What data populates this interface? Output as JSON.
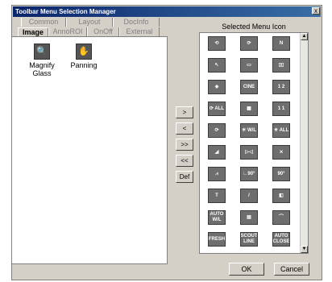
{
  "window": {
    "title": "Toolbar Menu Selection Manager",
    "close_label": "x"
  },
  "tabs": {
    "row1": [
      "Common",
      "Layout",
      "DocInfo"
    ],
    "row2": [
      "Image",
      "AnnoROI",
      "OnOff",
      "External"
    ],
    "active": "Image"
  },
  "available": [
    {
      "label": "Magnify Glass",
      "icon": "magnify-glass-icon",
      "glyph": "🔍"
    },
    {
      "label": "Panning",
      "icon": "hand-icon",
      "glyph": "✋"
    }
  ],
  "transfer_buttons": [
    ">",
    "<",
    ">>",
    "<<",
    "Def"
  ],
  "selected": {
    "header": "Selected Menu Icon",
    "icons": [
      {
        "name": "rotate-left-icon",
        "glyph": "⟲"
      },
      {
        "name": "rotate-right-icon",
        "glyph": "⟳"
      },
      {
        "name": "flip-icon",
        "glyph": "N"
      },
      {
        "name": "pointer-icon",
        "glyph": "↖"
      },
      {
        "name": "single-frame-icon",
        "glyph": "▭"
      },
      {
        "name": "dual-frame-icon",
        "glyph": "▯▯"
      },
      {
        "name": "stack-icon",
        "glyph": "◈"
      },
      {
        "name": "cine-icon",
        "glyph": "CINE"
      },
      {
        "name": "layout-1-2-icon",
        "glyph": "1 2"
      },
      {
        "name": "rotate-all-icon",
        "glyph": "⟳ ALL"
      },
      {
        "name": "grid-layout-icon",
        "glyph": "▦"
      },
      {
        "name": "layout-1-1-icon",
        "glyph": "1 1"
      },
      {
        "name": "rotate-icon",
        "glyph": "⟳"
      },
      {
        "name": "window-level-icon",
        "glyph": "☀ W/L"
      },
      {
        "name": "window-level-all-icon",
        "glyph": "☀ ALL"
      },
      {
        "name": "zoom-icon",
        "glyph": "◢"
      },
      {
        "name": "mirror-icon",
        "glyph": "▷◁"
      },
      {
        "name": "invert-icon",
        "glyph": "⨯"
      },
      {
        "name": "compass-icon",
        "glyph": "⩘"
      },
      {
        "name": "angle-90-icon",
        "glyph": "∟90°"
      },
      {
        "name": "angle-90-alt-icon",
        "glyph": "90°"
      },
      {
        "name": "text-icon",
        "glyph": "T"
      },
      {
        "name": "line-icon",
        "glyph": "/"
      },
      {
        "name": "contrast-icon",
        "glyph": "◧"
      },
      {
        "name": "auto-wl-icon",
        "glyph": "AUTO W/L"
      },
      {
        "name": "calendar-icon",
        "glyph": "▤"
      },
      {
        "name": "lasso-icon",
        "glyph": "⌒"
      },
      {
        "name": "fresh-icon",
        "glyph": "FRESH"
      },
      {
        "name": "scout-line-icon",
        "glyph": "SCOUT LINE"
      },
      {
        "name": "auto-close-icon",
        "glyph": "AUTO CLOSE"
      }
    ]
  },
  "footer": {
    "ok_label": "OK",
    "cancel_label": "Cancel"
  }
}
